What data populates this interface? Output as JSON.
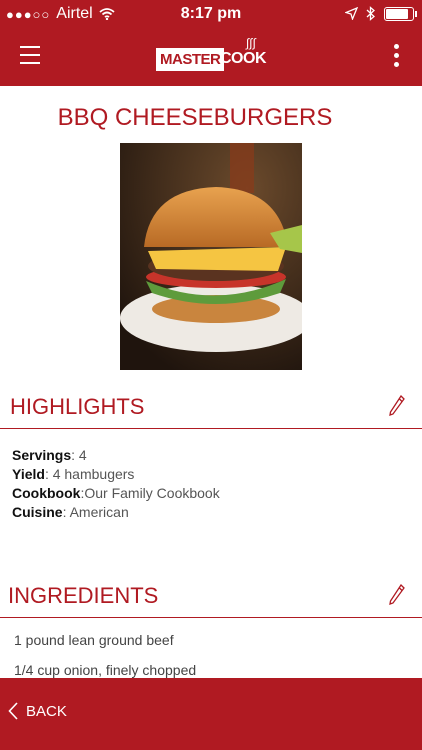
{
  "status_bar": {
    "signal": "●●●○○",
    "carrier": "Airtel",
    "time": "8:17 pm",
    "battery_level": 0.8
  },
  "app_bar": {
    "logo_master": "MASTER",
    "logo_cook": "COOK",
    "brand_color": "#b01a22"
  },
  "recipe": {
    "title": "BBQ CHEESEBURGERS"
  },
  "highlights": {
    "title": "HIGHLIGHTS",
    "servings_label": "Servings",
    "servings_value": "4",
    "yield_label": "Yield",
    "yield_value": "4 hambugers",
    "cookbook_label": "Cookbook",
    "cookbook_value": "Our Family Cookbook",
    "cuisine_label": "Cuisine",
    "cuisine_value": "American"
  },
  "ingredients": {
    "title": "INGREDIENTS",
    "items": [
      "1 pound lean ground beef",
      "1/4 cup onion, finely chopped"
    ]
  },
  "bottom_bar": {
    "back_label": "BACK"
  }
}
